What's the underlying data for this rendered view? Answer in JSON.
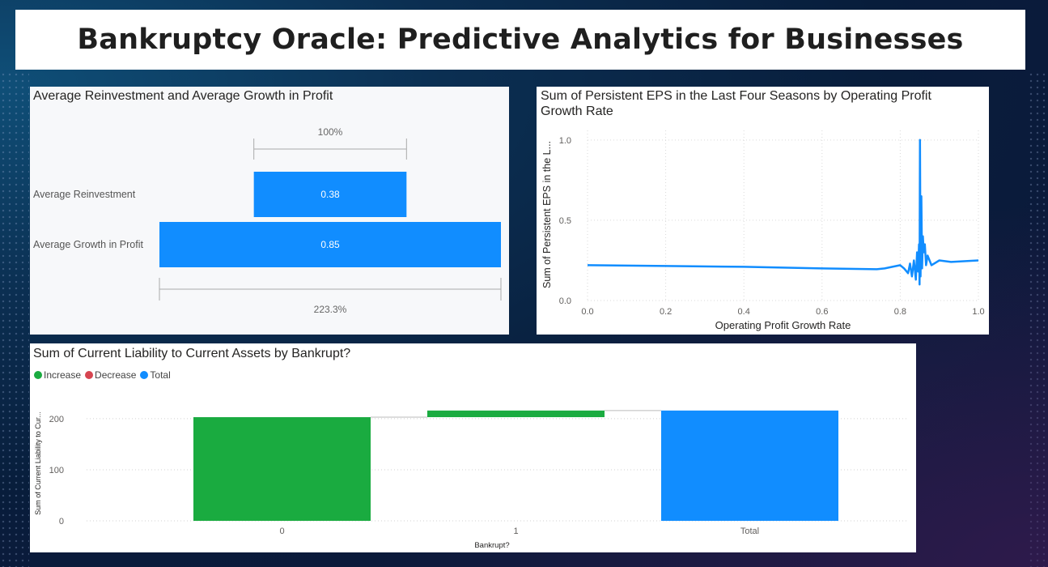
{
  "page": {
    "title": "Bankruptcy Oracle: Predictive Analytics for Businesses"
  },
  "colors": {
    "blue": "#118DFF",
    "green": "#1AAB40",
    "red": "#D64550",
    "panel_bg": "#F7F8FA"
  },
  "chart_data": [
    {
      "type": "bar",
      "subtype": "funnel",
      "title": "Average Reinvestment and Average Growth in Profit",
      "categories": [
        "Average Reinvestment",
        "Average Growth in Profit"
      ],
      "values": [
        0.38,
        0.85
      ],
      "value_labels": [
        "0.38",
        "0.85"
      ],
      "top_percent_label": "100%",
      "bottom_percent_label": "223.3%"
    },
    {
      "type": "line",
      "title": "Sum of Persistent EPS in the Last Four Seasons by Operating Profit Growth Rate",
      "xlabel": "Operating Profit Growth Rate",
      "ylabel": "Sum of Persistent EPS in the L...",
      "xlim": [
        0,
        1
      ],
      "ylim": [
        0,
        1.1
      ],
      "x_ticks": [
        "0.0",
        "0.2",
        "0.4",
        "0.6",
        "0.8",
        "1.0"
      ],
      "y_ticks": [
        "0.0",
        "0.5",
        "1.0"
      ],
      "grid": true,
      "series": [
        {
          "points": [
            [
              0.0,
              0.22
            ],
            [
              0.2,
              0.215
            ],
            [
              0.4,
              0.21
            ],
            [
              0.6,
              0.2
            ],
            [
              0.74,
              0.195
            ],
            [
              0.76,
              0.2
            ],
            [
              0.78,
              0.21
            ],
            [
              0.8,
              0.22
            ],
            [
              0.81,
              0.2
            ],
            [
              0.82,
              0.17
            ],
            [
              0.825,
              0.23
            ],
            [
              0.83,
              0.15
            ],
            [
              0.835,
              0.25
            ],
            [
              0.84,
              0.13
            ],
            [
              0.843,
              0.3
            ],
            [
              0.846,
              0.18
            ],
            [
              0.848,
              0.35
            ],
            [
              0.8495,
              0.1
            ],
            [
              0.8505,
              1.0
            ],
            [
              0.852,
              0.15
            ],
            [
              0.854,
              0.65
            ],
            [
              0.856,
              0.2
            ],
            [
              0.858,
              0.4
            ],
            [
              0.86,
              0.3
            ],
            [
              0.863,
              0.35
            ],
            [
              0.866,
              0.22
            ],
            [
              0.87,
              0.28
            ],
            [
              0.88,
              0.22
            ],
            [
              0.9,
              0.25
            ],
            [
              0.93,
              0.24
            ],
            [
              1.0,
              0.25
            ]
          ]
        }
      ]
    },
    {
      "type": "bar",
      "subtype": "waterfall",
      "title": "Sum of Current Liability to Current Assets by Bankrupt?",
      "xlabel": "Bankrupt?",
      "ylabel": "Sum of Current Liability to Cur...",
      "categories": [
        "0",
        "1",
        "Total"
      ],
      "steps": [
        {
          "category": "0",
          "kind": "Increase",
          "start": 0,
          "end": 203
        },
        {
          "category": "1",
          "kind": "Increase",
          "start": 203,
          "end": 216
        },
        {
          "category": "Total",
          "kind": "Total",
          "start": 0,
          "end": 216
        }
      ],
      "ylim": [
        0,
        230
      ],
      "y_ticks": [
        "0",
        "100",
        "200"
      ],
      "legend": [
        "Increase",
        "Decrease",
        "Total"
      ],
      "legend_position": "top-left",
      "grid": true
    }
  ]
}
